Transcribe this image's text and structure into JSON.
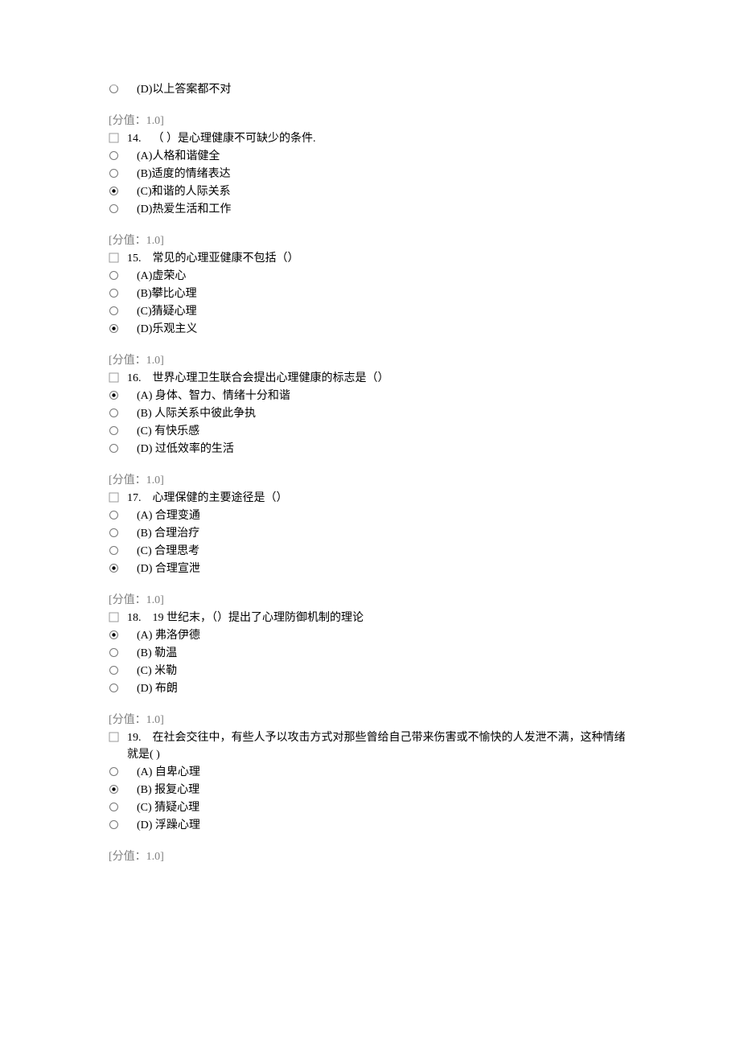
{
  "score_label": "[分值：1.0]",
  "blocks": [
    {
      "leading_option": {
        "letter": "D",
        "text": "(D)以上答案都不对",
        "selected": false
      },
      "num": "14.",
      "question": "（ ）是心理健康不可缺少的条件.",
      "options": [
        {
          "text": "(A)人格和谐健全",
          "selected": false
        },
        {
          "text": "(B)适度的情绪表达",
          "selected": false
        },
        {
          "text": "(C)和谐的人际关系",
          "selected": true
        },
        {
          "text": "(D)热爱生活和工作",
          "selected": false
        }
      ]
    },
    {
      "num": "15.",
      "question": "常见的心理亚健康不包括（）",
      "options": [
        {
          "text": "(A)虚荣心",
          "selected": false
        },
        {
          "text": "(B)攀比心理",
          "selected": false
        },
        {
          "text": "(C)猜疑心理",
          "selected": false
        },
        {
          "text": "(D)乐观主义",
          "selected": true
        }
      ]
    },
    {
      "num": "16.",
      "question": "世界心理卫生联合会提出心理健康的标志是（）",
      "options": [
        {
          "text": "(A) 身体、智力、情绪十分和谐",
          "selected": true
        },
        {
          "text": "(B) 人际关系中彼此争执",
          "selected": false
        },
        {
          "text": "(C) 有快乐感",
          "selected": false
        },
        {
          "text": "(D) 过低效率的生活",
          "selected": false
        }
      ]
    },
    {
      "num": "17.",
      "question": "心理保健的主要途径是（）",
      "options": [
        {
          "text": "(A) 合理变通",
          "selected": false
        },
        {
          "text": "(B) 合理治疗",
          "selected": false
        },
        {
          "text": "(C) 合理思考",
          "selected": false
        },
        {
          "text": "(D) 合理宣泄",
          "selected": true
        }
      ]
    },
    {
      "num": "18.",
      "question": "19 世纪末，（）提出了心理防御机制的理论",
      "options": [
        {
          "text": "(A) 弗洛伊德",
          "selected": true
        },
        {
          "text": "(B) 勒温",
          "selected": false
        },
        {
          "text": "(C) 米勒",
          "selected": false
        },
        {
          "text": "(D) 布朗",
          "selected": false
        }
      ]
    },
    {
      "num": "19.",
      "question": "在社会交往中，有些人予以攻击方式对那些曾给自己带来伤害或不愉快的人发泄不满，这种情绪就是(   )",
      "question_wrap": true,
      "options": [
        {
          "text": "(A) 自卑心理",
          "selected": false
        },
        {
          "text": "(B) 报复心理",
          "selected": true
        },
        {
          "text": "(C) 猜疑心理",
          "selected": false
        },
        {
          "text": "(D) 浮躁心理",
          "selected": false
        }
      ]
    }
  ]
}
